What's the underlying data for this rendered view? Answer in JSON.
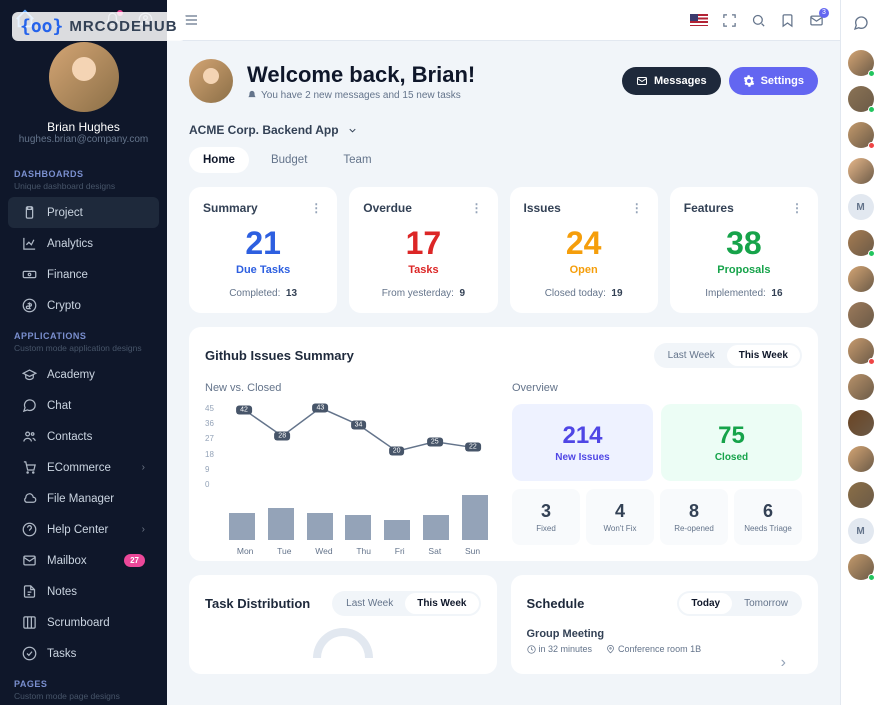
{
  "watermark": "MRCODEHUB",
  "user": {
    "name": "Brian Hughes",
    "email": "hughes.brian@company.com"
  },
  "sidebar": {
    "sections": [
      {
        "header": "DASHBOARDS",
        "sub": "Unique dashboard designs",
        "items": [
          {
            "label": "Project",
            "icon": "clipboard",
            "active": true
          },
          {
            "label": "Analytics",
            "icon": "chart"
          },
          {
            "label": "Finance",
            "icon": "cash"
          },
          {
            "label": "Crypto",
            "icon": "dollar"
          }
        ]
      },
      {
        "header": "APPLICATIONS",
        "sub": "Custom mode application designs",
        "items": [
          {
            "label": "Academy",
            "icon": "cap"
          },
          {
            "label": "Chat",
            "icon": "chat"
          },
          {
            "label": "Contacts",
            "icon": "users"
          },
          {
            "label": "ECommerce",
            "icon": "cart",
            "chev": true
          },
          {
            "label": "File Manager",
            "icon": "cloud"
          },
          {
            "label": "Help Center",
            "icon": "help",
            "chev": true
          },
          {
            "label": "Mailbox",
            "icon": "mail",
            "badge": "27"
          },
          {
            "label": "Notes",
            "icon": "note"
          },
          {
            "label": "Scrumboard",
            "icon": "board"
          },
          {
            "label": "Tasks",
            "icon": "check"
          }
        ]
      },
      {
        "header": "PAGES",
        "sub": "Custom mode page designs",
        "items": []
      }
    ]
  },
  "topbar": {
    "mail_badge": "3"
  },
  "welcome": {
    "title": "Welcome back, Brian!",
    "sub": "You have 2 new messages and 15 new tasks",
    "btn_messages": "Messages",
    "btn_settings": "Settings"
  },
  "app_selector": "ACME Corp. Backend App",
  "tabs": {
    "home": "Home",
    "budget": "Budget",
    "team": "Team"
  },
  "summary_cards": [
    {
      "title": "Summary",
      "value": "21",
      "label": "Due Tasks",
      "sub_label": "Completed:",
      "sub_value": "13",
      "color": "c-blue"
    },
    {
      "title": "Overdue",
      "value": "17",
      "label": "Tasks",
      "sub_label": "From yesterday:",
      "sub_value": "9",
      "color": "c-red"
    },
    {
      "title": "Issues",
      "value": "24",
      "label": "Open",
      "sub_label": "Closed today:",
      "sub_value": "19",
      "color": "c-amber"
    },
    {
      "title": "Features",
      "value": "38",
      "label": "Proposals",
      "sub_label": "Implemented:",
      "sub_value": "16",
      "color": "c-green"
    }
  ],
  "github": {
    "title": "Github Issues Summary",
    "range": {
      "last": "Last Week",
      "this": "This Week"
    },
    "chart_title": "New vs. Closed",
    "overview_title": "Overview",
    "overview_big": [
      {
        "n": "214",
        "l": "New Issues",
        "color": "#4f46e5"
      },
      {
        "n": "75",
        "l": "Closed",
        "color": "#16a34a"
      }
    ],
    "overview_small": [
      {
        "n": "3",
        "l": "Fixed"
      },
      {
        "n": "4",
        "l": "Won't Fix"
      },
      {
        "n": "8",
        "l": "Re-opened"
      },
      {
        "n": "6",
        "l": "Needs Triage"
      }
    ]
  },
  "chart_data": {
    "type": "line+bar",
    "title": "New vs. Closed",
    "categories": [
      "Mon",
      "Tue",
      "Wed",
      "Thu",
      "Fri",
      "Sat",
      "Sun"
    ],
    "yticks": [
      45,
      36,
      27,
      18,
      9,
      0
    ],
    "line_values": [
      42,
      28,
      43,
      34,
      20,
      25,
      22
    ],
    "bar_values": [
      11,
      13,
      11,
      10,
      8,
      10,
      18
    ]
  },
  "task_dist": {
    "title": "Task Distribution",
    "range": {
      "last": "Last Week",
      "this": "This Week"
    }
  },
  "schedule": {
    "title": "Schedule",
    "range": {
      "today": "Today",
      "tomorrow": "Tomorrow"
    },
    "item": {
      "title": "Group Meeting",
      "time": "in 32 minutes",
      "loc": "Conference room 1B"
    }
  },
  "contacts": [
    {
      "color": "#d4a574",
      "status": "#22c55e"
    },
    {
      "color": "#8b7355",
      "status": "#22c55e"
    },
    {
      "color": "#c49a6c",
      "status": "#ef4444"
    },
    {
      "color": "#e8b88a",
      "status": ""
    },
    {
      "initial": "M",
      "status": ""
    },
    {
      "color": "#a67c52",
      "status": "#22c55e"
    },
    {
      "color": "#d4a574",
      "status": ""
    },
    {
      "color": "#9c7a5b",
      "status": ""
    },
    {
      "color": "#c89b6e",
      "status": "#ef4444"
    },
    {
      "color": "#b8926a",
      "status": ""
    },
    {
      "color": "#6b4423",
      "status": ""
    },
    {
      "color": "#d4a574",
      "status": ""
    },
    {
      "color": "#8b6f47",
      "status": ""
    },
    {
      "initial": "M",
      "status": ""
    },
    {
      "color": "#c49a6c",
      "status": "#22c55e"
    }
  ]
}
